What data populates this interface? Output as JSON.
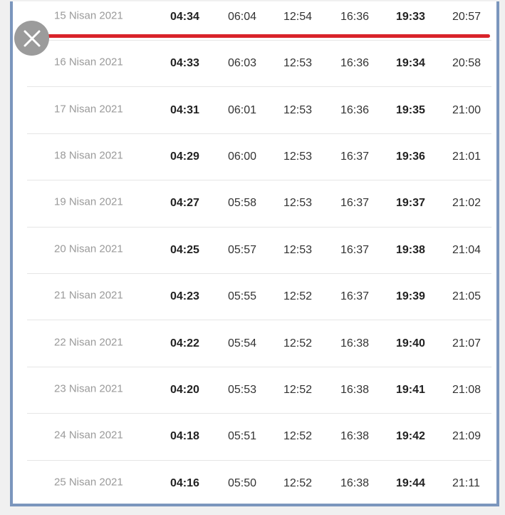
{
  "rows": [
    {
      "date": "15 Nisan 2021",
      "t1": "04:34",
      "t2": "06:04",
      "t3": "12:54",
      "t4": "16:36",
      "t5": "19:33",
      "t6": "20:57"
    },
    {
      "date": "16 Nisan 2021",
      "t1": "04:33",
      "t2": "06:03",
      "t3": "12:53",
      "t4": "16:36",
      "t5": "19:34",
      "t6": "20:58"
    },
    {
      "date": "17 Nisan 2021",
      "t1": "04:31",
      "t2": "06:01",
      "t3": "12:53",
      "t4": "16:36",
      "t5": "19:35",
      "t6": "21:00"
    },
    {
      "date": "18 Nisan 2021",
      "t1": "04:29",
      "t2": "06:00",
      "t3": "12:53",
      "t4": "16:37",
      "t5": "19:36",
      "t6": "21:01"
    },
    {
      "date": "19 Nisan 2021",
      "t1": "04:27",
      "t2": "05:58",
      "t3": "12:53",
      "t4": "16:37",
      "t5": "19:37",
      "t6": "21:02"
    },
    {
      "date": "20 Nisan 2021",
      "t1": "04:25",
      "t2": "05:57",
      "t3": "12:53",
      "t4": "16:37",
      "t5": "19:38",
      "t6": "21:04"
    },
    {
      "date": "21 Nisan 2021",
      "t1": "04:23",
      "t2": "05:55",
      "t3": "12:52",
      "t4": "16:37",
      "t5": "19:39",
      "t6": "21:05"
    },
    {
      "date": "22 Nisan 2021",
      "t1": "04:22",
      "t2": "05:54",
      "t3": "12:52",
      "t4": "16:38",
      "t5": "19:40",
      "t6": "21:07"
    },
    {
      "date": "23 Nisan 2021",
      "t1": "04:20",
      "t2": "05:53",
      "t3": "12:52",
      "t4": "16:38",
      "t5": "19:41",
      "t6": "21:08"
    },
    {
      "date": "24 Nisan 2021",
      "t1": "04:18",
      "t2": "05:51",
      "t3": "12:52",
      "t4": "16:38",
      "t5": "19:42",
      "t6": "21:09"
    },
    {
      "date": "25 Nisan 2021",
      "t1": "04:16",
      "t2": "05:50",
      "t3": "12:52",
      "t4": "16:38",
      "t5": "19:44",
      "t6": "21:11"
    }
  ],
  "colors": {
    "frame_border": "#7b96bd",
    "highlight_line": "#d9232a",
    "close_button_bg": "#9b9b9b"
  },
  "icons": {
    "close": "close-icon"
  }
}
